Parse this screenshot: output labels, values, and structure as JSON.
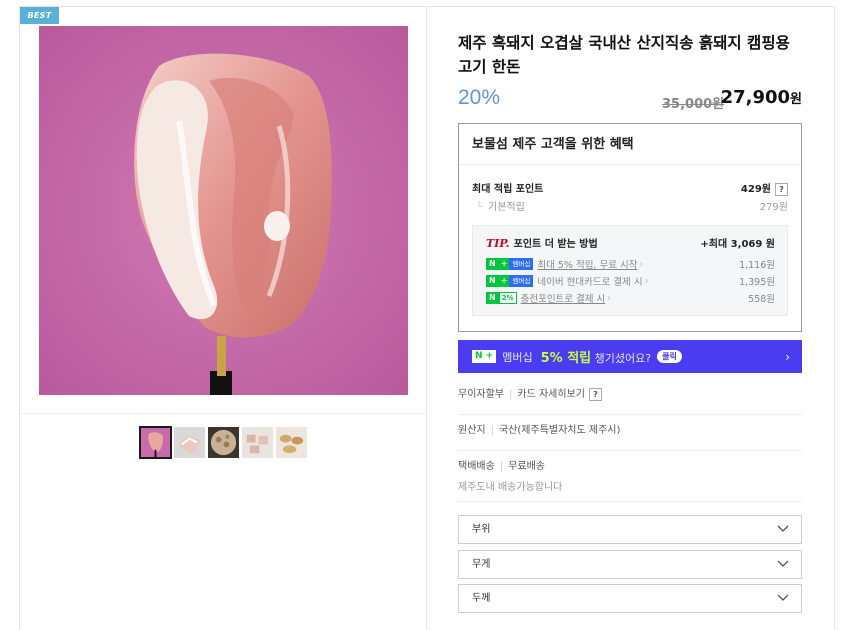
{
  "badge": "BEST",
  "product": {
    "title": "제주 흑돼지 오겹살 국내산 산지직송 흙돼지 캠핑용 고기 한돈",
    "discount": "20%",
    "original_price": "35,000원",
    "sale_price": "27,900",
    "sale_unit": "원"
  },
  "benefit": {
    "title": "보물섬 제주 고객을 위한 혜택",
    "max_points_label": "최대 적립 포인트",
    "max_points_value": "429원",
    "help": "?",
    "base_label": "기본적립",
    "base_value": "279원",
    "tip": {
      "brand": "TIP.",
      "title": "포인트 더 받는 방법",
      "total": "+최대 3,069 원",
      "rows": [
        {
          "badge_n": "N",
          "badge_plus": "+",
          "badge_text": "멤버십",
          "label": "최대 5% 적립, 무료 시작",
          "value": "1,116원"
        },
        {
          "badge_n": "N",
          "badge_plus": "+",
          "badge_text": "멤버십",
          "label": "네이버 현대카드로 결제 시",
          "value": "1,395원"
        },
        {
          "badge_n": "N",
          "badge_plus": "",
          "badge_text": "2%",
          "label": "충전포인트로 결제 시",
          "value": "558원"
        }
      ]
    }
  },
  "banner": {
    "logo": "N +",
    "membership": "멤버십",
    "highlight": "5% 적립",
    "text": "챙기셨어요?",
    "pill": "클릭",
    "arrow": "›"
  },
  "payment": {
    "installment": "무이자할부",
    "card_details": "카드 자세히보기",
    "help": "?"
  },
  "origin": {
    "label": "원산지",
    "value": "국산(제주특별자치도 제주시)"
  },
  "delivery": {
    "method": "택배배송",
    "fee": "무료배송",
    "note": "제주도내 배송가능합니다"
  },
  "options": [
    {
      "label": "부위"
    },
    {
      "label": "무게"
    },
    {
      "label": "두께"
    }
  ],
  "colors": {
    "accent": "#5f95d9",
    "banner": "#4a3cf0",
    "naver_green": "#00c73c",
    "bg_pink": "#c96aaa"
  }
}
